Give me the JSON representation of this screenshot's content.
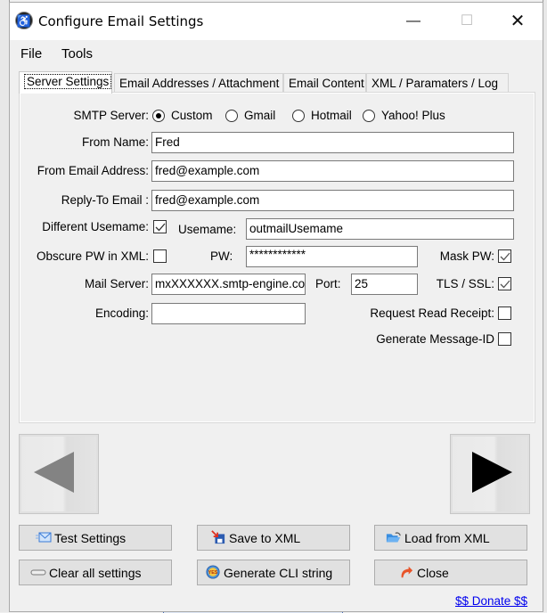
{
  "window": {
    "title": "Configure Email Settings",
    "controls": {
      "minimize": "—",
      "maximize": "☐",
      "close": "✕"
    },
    "app_icon_glyph": "♿"
  },
  "menu": {
    "items": [
      "File",
      "Tools"
    ]
  },
  "tabs": [
    {
      "label": "Server Settings",
      "active": true
    },
    {
      "label": "Email Addresses / Attachment",
      "active": false
    },
    {
      "label": "Email Content",
      "active": false
    },
    {
      "label": "XML / Paramaters / Log",
      "active": false
    }
  ],
  "server_settings": {
    "smtp_label": "SMTP Server:",
    "smtp_options": [
      {
        "label": "Custom",
        "selected": true
      },
      {
        "label": "Gmail",
        "selected": false
      },
      {
        "label": "Hotmail",
        "selected": false
      },
      {
        "label": "Yahoo! Plus",
        "selected": false
      }
    ],
    "from_name_label": "From Name:",
    "from_name_value": "Fred",
    "from_email_label": "From Email Address:",
    "from_email_value": "fred@example.com",
    "reply_to_label": "Reply-To Email :",
    "reply_to_value": "fred@example.com",
    "different_username_label": "Different Usemame:",
    "different_username_checked": true,
    "username_label": "Usemame:",
    "username_value": "outmailUsemame",
    "obscure_pw_label": "Obscure PW in XML:",
    "obscure_pw_checked": false,
    "pw_label": "PW:",
    "pw_value": "************",
    "mask_pw_label": "Mask PW:",
    "mask_pw_checked": true,
    "mail_server_label": "Mail Server:",
    "mail_server_value": "mxXXXXXX.smtp-engine.com",
    "port_label": "Port:",
    "port_value": "25",
    "tls_label": "TLS / SSL:",
    "tls_checked": true,
    "encoding_label": "Encoding:",
    "encoding_value": "",
    "read_receipt_label": "Request Read Receipt:",
    "read_receipt_checked": false,
    "message_id_label": "Generate Message-ID",
    "message_id_checked": false
  },
  "navigation": {
    "prev_icon": "triangle-left",
    "next_icon": "triangle-right",
    "prev_enabled": false,
    "next_enabled": true
  },
  "buttons": {
    "test_settings": "Test Settings",
    "save_xml": "Save to XML",
    "load_xml": "Load from XML",
    "clear_settings": "Clear all settings",
    "generate_cli": "Generate CLI string",
    "close": "Close"
  },
  "donate_link": "$$ Donate $$"
}
